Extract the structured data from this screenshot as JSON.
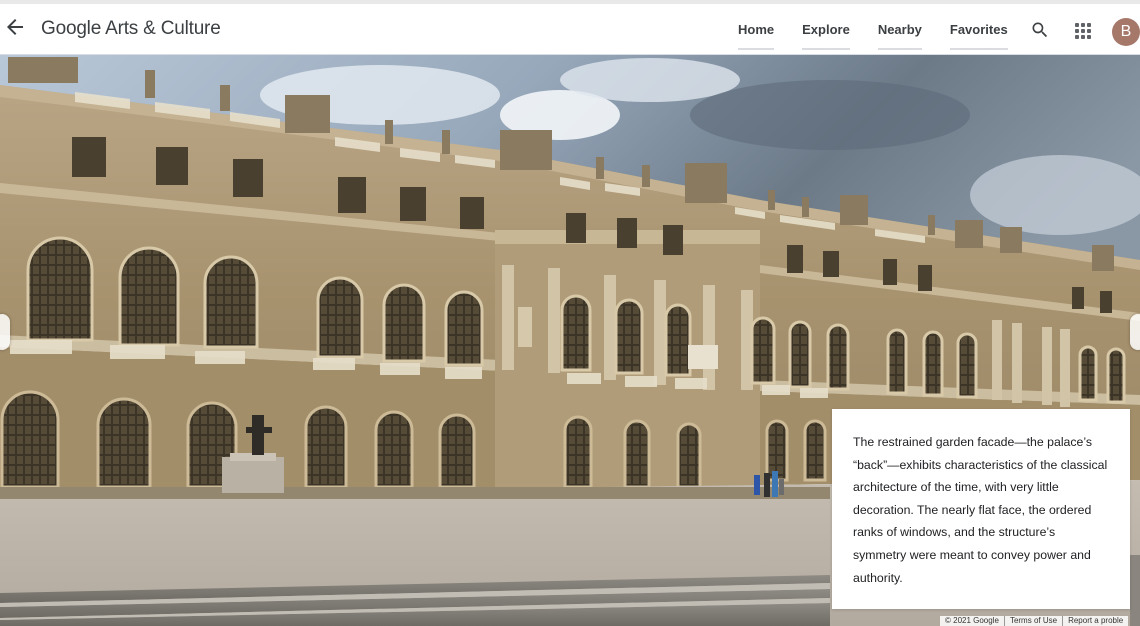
{
  "header": {
    "logo_text": "Google Arts & Culture",
    "nav": [
      {
        "label": "Home"
      },
      {
        "label": "Explore"
      },
      {
        "label": "Nearby"
      },
      {
        "label": "Favorites"
      }
    ],
    "avatar_initial": "B",
    "avatar_color": "#a5786a"
  },
  "viewer": {
    "info_text": "The restrained garden facade—the palace’s “back”—exhibits characteristics of the classical architecture of the time, with very little decoration. The nearly flat face, the ordered ranks of windows, and the structure’s symmetry were meant to convey power and authority."
  },
  "footer": {
    "copyright": "© 2021 Google",
    "terms": "Terms of Use",
    "report": "Report a proble"
  },
  "colors": {
    "accent_underline": "#dadce0",
    "text_primary": "#3c4043",
    "icon": "#5f6368"
  },
  "icons": {
    "back": "arrow-left-icon",
    "search": "search-icon",
    "apps": "apps-grid-icon"
  }
}
